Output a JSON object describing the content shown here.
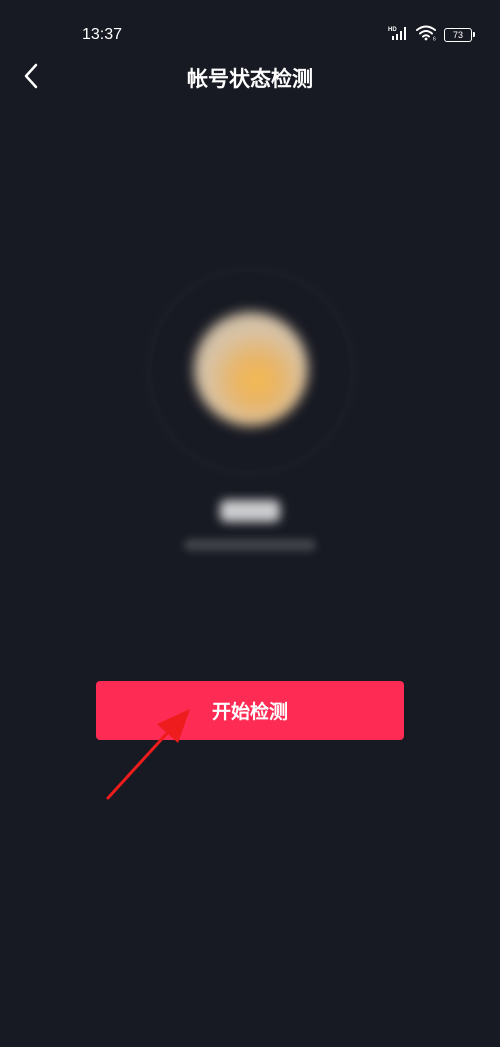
{
  "status_bar": {
    "time": "13:37",
    "battery": "73"
  },
  "nav": {
    "title": "帐号状态检测"
  },
  "main": {
    "start_button_label": "开始检测"
  },
  "colors": {
    "background": "#181a23",
    "accent": "#fe2c55",
    "annotation": "#ee1c1c"
  }
}
